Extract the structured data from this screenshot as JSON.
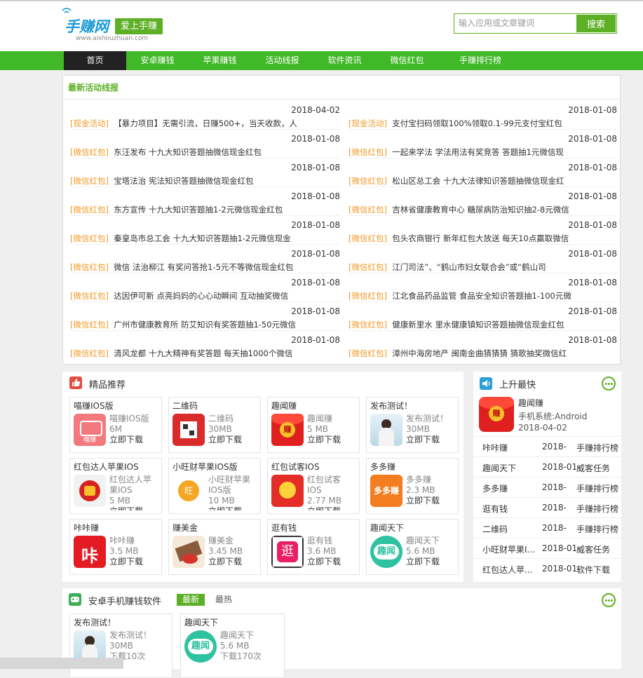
{
  "header": {
    "logo_text": "手赚网",
    "logo_url": "www.aishouzhuan.com",
    "slogan": "爱上手赚",
    "search_placeholder": "输入应用或文章键词",
    "search_button": "搜索"
  },
  "nav": [
    "首页",
    "安卓赚钱",
    "苹果赚钱",
    "活动线报",
    "软件资讯",
    "微信红包",
    "手赚排行榜"
  ],
  "news": {
    "title": "最新活动线报",
    "left": [
      {
        "date": "2018-04-02",
        "tag": "[现金活动]",
        "text": "【暴力项目】无需引流，日赚500+，当天收款，人"
      },
      {
        "date": "2018-01-08",
        "tag": "[微信红包]",
        "text": "东汪发布 十九大知识答题抽微信现金红包"
      },
      {
        "date": "2018-01-08",
        "tag": "[微信红包]",
        "text": "宝塔法治 宪法知识答题抽微信现金红包"
      },
      {
        "date": "2018-01-08",
        "tag": "[微信红包]",
        "text": "东方宣传 十九大知识答题抽1-2元微信现金红包"
      },
      {
        "date": "2018-01-08",
        "tag": "[微信红包]",
        "text": "秦皇岛市总工会 十九大知识答题抽1-2元微信现金"
      },
      {
        "date": "2018-01-08",
        "tag": "[微信红包]",
        "text": "微信 法治柳江 有奖问答抢1-5元不等微信现金红包"
      },
      {
        "date": "2018-01-08",
        "tag": "[微信红包]",
        "text": "达因伊可新 点亮妈妈的心心动瞬间 互动抽奖微信"
      },
      {
        "date": "2018-01-08",
        "tag": "[微信红包]",
        "text": "广州市健康教育所 防艾知识有奖答题抽1-50元微信"
      },
      {
        "date": "2018-01-08",
        "tag": "[微信红包]",
        "text": "清风龙都 十九大精神有奖答题 每天抽1000个微信"
      }
    ],
    "right": [
      {
        "date": "2018-01-08",
        "tag": "[现金活动]",
        "text": "支付宝扫码领取100%领取0.1-99元支付宝红包"
      },
      {
        "date": "2018-01-08",
        "tag": "[微信红包]",
        "text": "一起来学法 学法用法有奖竞答 答题抽1元微信现"
      },
      {
        "date": "2018-01-08",
        "tag": "[微信红包]",
        "text": "松山区总工会 十九大法律知识答题抽微信现金红"
      },
      {
        "date": "2018-01-08",
        "tag": "[微信红包]",
        "text": "吉林省健康教育中心 糖尿病防治知识抽2-8元微信"
      },
      {
        "date": "2018-01-08",
        "tag": "[微信红包]",
        "text": "包头农商银行 新年红包大放送 每天10点赢取微信"
      },
      {
        "date": "2018-01-08",
        "tag": "[微信红包]",
        "text": "江门司法”、“鹤山市妇女联合会”或“鹤山司"
      },
      {
        "date": "2018-01-08",
        "tag": "[微信红包]",
        "text": "江北食品药品监管 食品安全知识答题抽1-100元微"
      },
      {
        "date": "2018-01-08",
        "tag": "[微信红包]",
        "text": "健康新里水 里水健康镇知识答题抽微信现金红包"
      },
      {
        "date": "2018-01-08",
        "tag": "[微信红包]",
        "text": "漳州中海房地产 闽南金曲猜猜猜 猜歌抽奖微信红"
      }
    ]
  },
  "featured": {
    "title": "精品推荐",
    "download_label": "立即下载",
    "cards": [
      {
        "name": "喵赚IOS版",
        "l1": "喵赚IOS版",
        "l2": "6M",
        "icon": "miao-zhuan-app-icon"
      },
      {
        "name": "二维码",
        "l1": "二维码",
        "l2": "30MB",
        "icon": "qr-code-app-icon"
      },
      {
        "name": "趣闻赚",
        "l1": "趣闻赚",
        "l2": "5 MB",
        "icon": "red-envelope-app-icon"
      },
      {
        "name": "发布测试！",
        "l1": "发布测试！",
        "l2": "30MB",
        "icon": "photo-app-icon"
      },
      {
        "name": "红包达人苹果IOS",
        "l1": "红包达人苹",
        "l1b": "果IOS",
        "l2": "5 MB",
        "icon": "red-packet-master-app-icon"
      },
      {
        "name": "小旺财苹果IOS版",
        "l1": "小旺财苹果",
        "l1b": "IOS版",
        "l2": "10 MB",
        "icon": "xiao-wang-cai-app-icon"
      },
      {
        "name": "红包试客IOS",
        "l1": "红包试客",
        "l1b": "IOS",
        "l2": "2.77 MB",
        "icon": "red-packet-trial-app-icon"
      },
      {
        "name": "多多赚",
        "l1": "多多赚",
        "l2": "2.3 MB",
        "icon": "duo-duo-zhuan-app-icon"
      },
      {
        "name": "咔咔赚",
        "l1": "咔咔赚",
        "l2": "3.5 MB",
        "icon": "ka-ka-zhuan-app-icon"
      },
      {
        "name": "赚美金",
        "l1": "赚美金",
        "l2": "3.45 MB",
        "icon": "zhuan-mei-jin-app-icon"
      },
      {
        "name": "逛有钱",
        "l1": "逛有钱",
        "l2": "3.6 MB",
        "icon": "guang-you-qian-app-icon"
      },
      {
        "name": "趣闻天下",
        "l1": "趣闻天下",
        "l2": "5.6 MB",
        "icon": "qu-wen-tian-xia-app-icon"
      }
    ]
  },
  "ranking": {
    "title": "上升最快",
    "top": {
      "name": "趣闻赚",
      "system": "手机系统:Android",
      "date": "2018-04-02"
    },
    "rows": [
      {
        "name": "咔咔赚",
        "date": "2018-",
        "cat": "手赚排行榜"
      },
      {
        "name": "趣闻天下",
        "date": "2018-01-",
        "cat": "威客任务"
      },
      {
        "name": "多多赚",
        "date": "2018-",
        "cat": "手赚排行榜"
      },
      {
        "name": "逛有钱",
        "date": "2018-",
        "cat": "手赚排行榜"
      },
      {
        "name": "二维码",
        "date": "2018-",
        "cat": "手赚排行榜"
      },
      {
        "name": "小旺财苹果I...",
        "date": "2018-01-",
        "cat": "威客任务"
      },
      {
        "name": "红包达人苹...",
        "date": "2018-01-",
        "cat": "软件下载"
      }
    ]
  },
  "android": {
    "title": "安卓手机赚钱软件",
    "tab_new": "最新",
    "tab_hot": "最热",
    "cards": [
      {
        "name": "发布测试！",
        "l1": "发布测试！",
        "l2": "30MB",
        "l3": "下载10次"
      },
      {
        "name": "趣闻天下",
        "l1": "趣闻天下",
        "l2": "5.6 MB",
        "l3": "下载170次"
      }
    ]
  },
  "colors": {
    "brand_green": "#5db025",
    "nav_green": "#41b828",
    "tag_orange": "#f09a28",
    "logo_blue": "#1d9ad6"
  }
}
